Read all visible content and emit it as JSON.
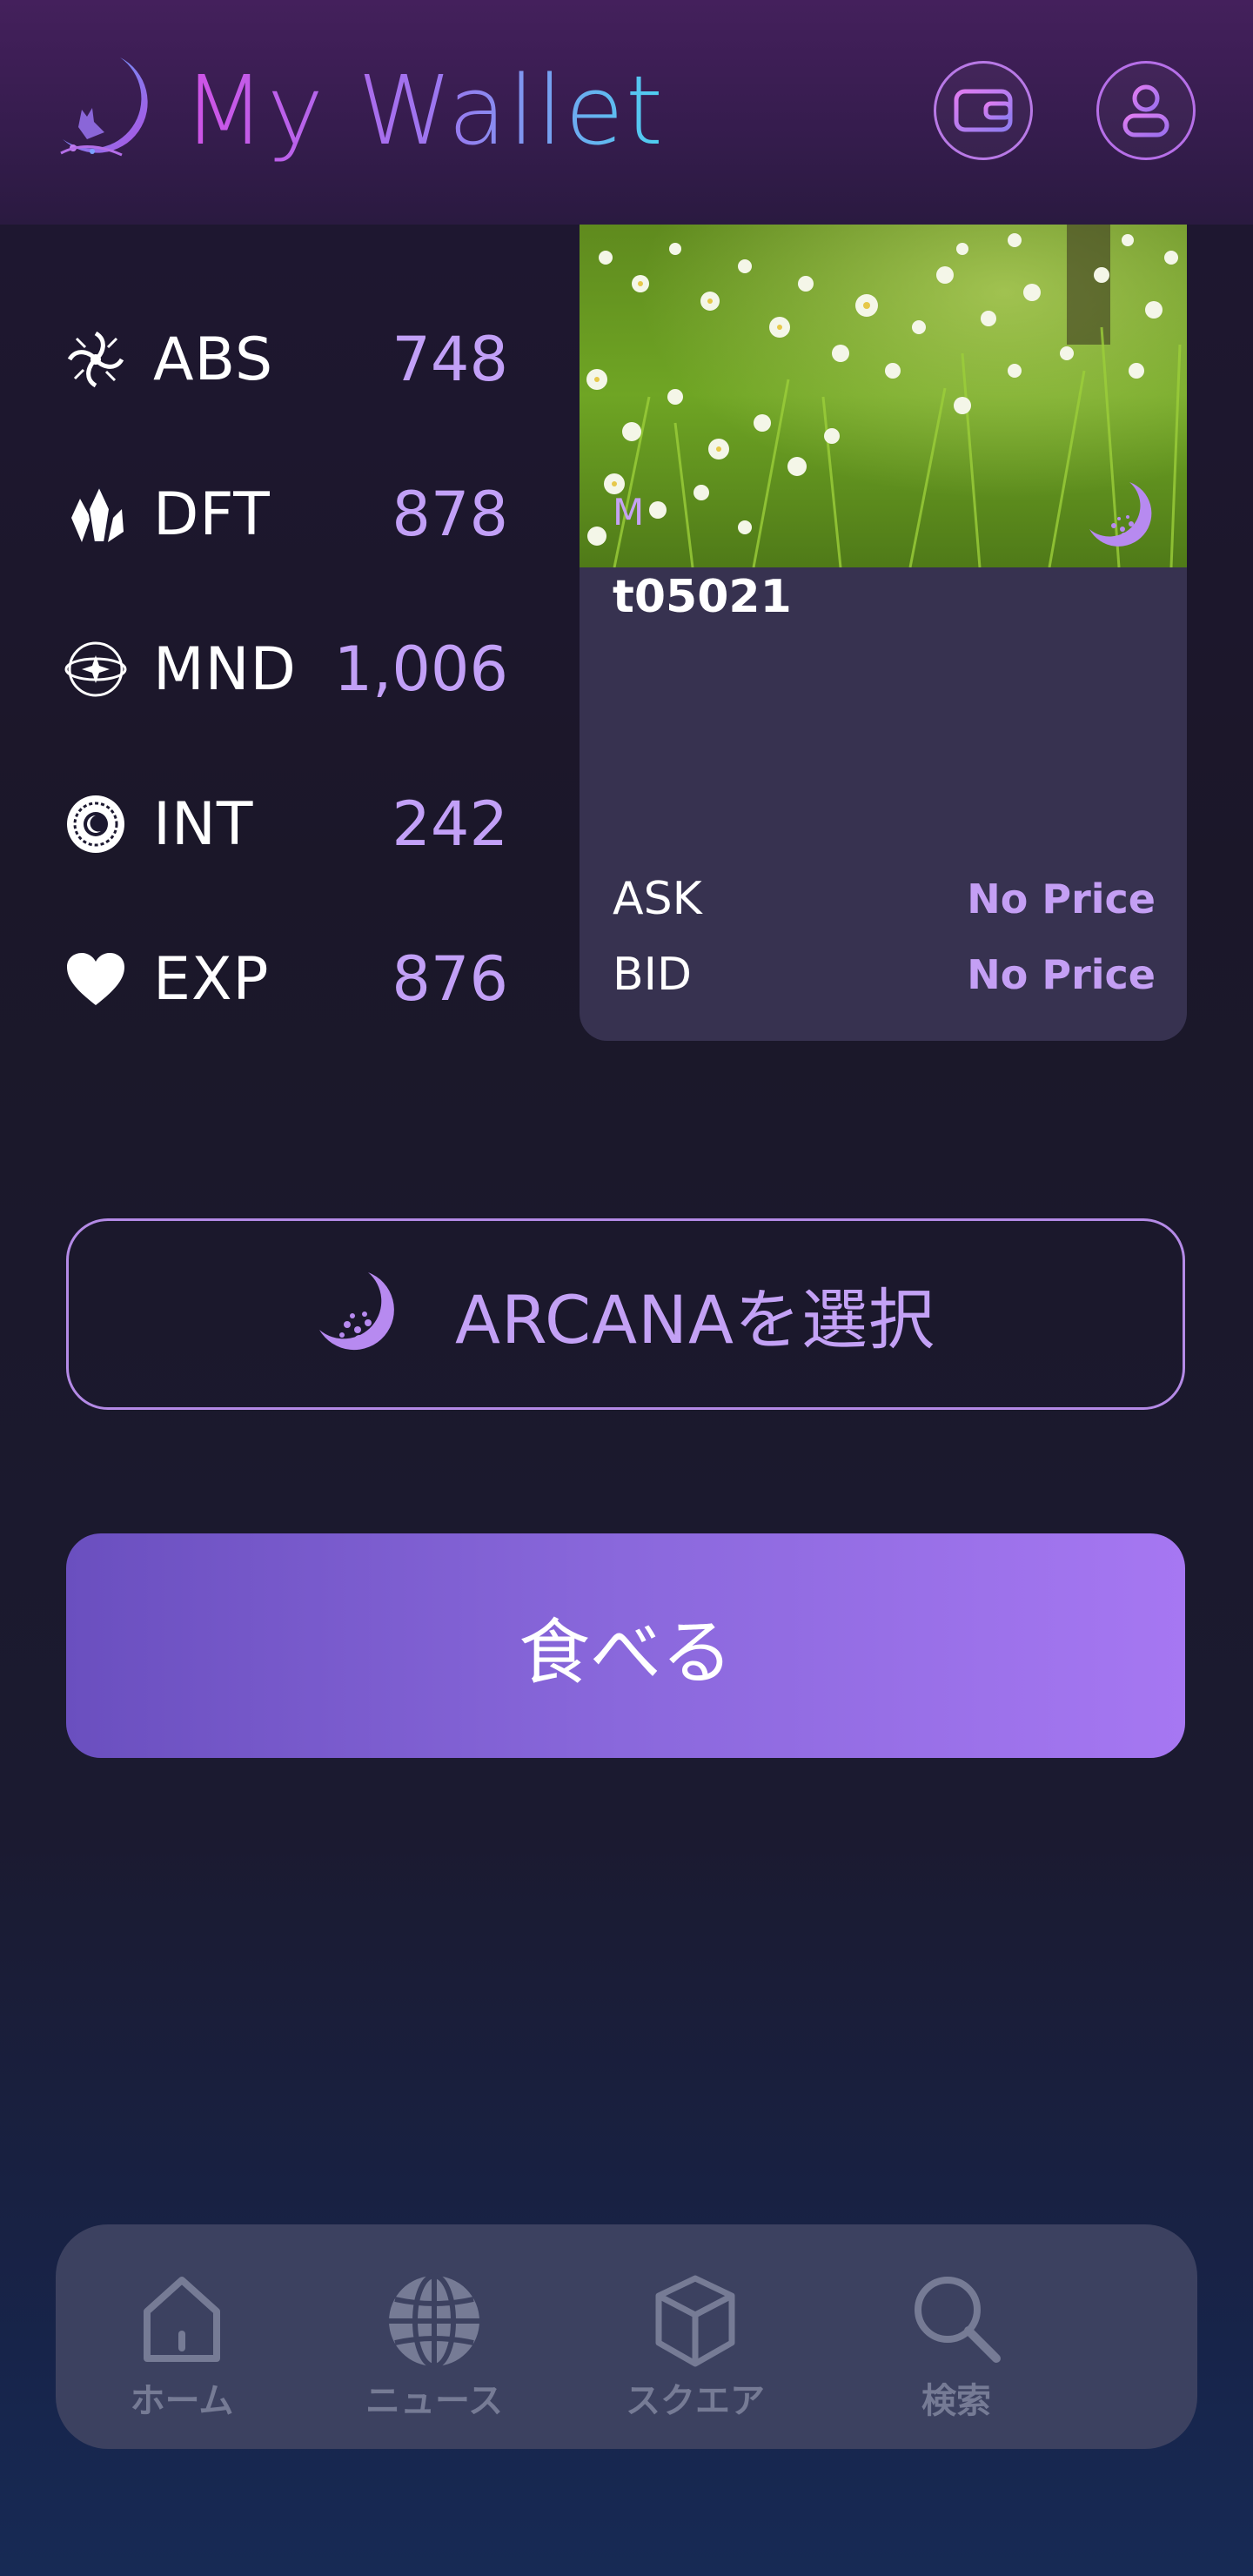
{
  "header": {
    "title": "My Wallet",
    "wallet_icon": "wallet-icon",
    "profile_icon": "user-icon"
  },
  "stats": [
    {
      "icon": "tribal-swirl-icon",
      "label": "ABS",
      "value": "748"
    },
    {
      "icon": "crystal-icon",
      "label": "DFT",
      "value": "878"
    },
    {
      "icon": "orbit-star-icon",
      "label": "MND",
      "value": "1,006"
    },
    {
      "icon": "zodiac-wheel-icon",
      "label": "INT",
      "value": "242"
    },
    {
      "icon": "heart-icon",
      "label": "EXP",
      "value": "876"
    }
  ],
  "card": {
    "kind": "M",
    "name": "t05021",
    "ask_label": "ASK",
    "ask_value": "No Price",
    "bid_label": "BID",
    "bid_value": "No Price",
    "image": "white-anemone-flower-field"
  },
  "buttons": {
    "arcana_label": "ARCANAを選択",
    "eat_label": "食べる"
  },
  "nav": [
    {
      "icon": "home-icon",
      "label": "ホーム"
    },
    {
      "icon": "globe-icon",
      "label": "ニュース"
    },
    {
      "icon": "cube-icon",
      "label": "スクエア"
    },
    {
      "icon": "search-icon",
      "label": "検索"
    }
  ],
  "colors": {
    "accent": "#c2a0f7",
    "card_bg": "#373250",
    "nav_bg": "#3c4160",
    "nav_label": "#767b95"
  }
}
